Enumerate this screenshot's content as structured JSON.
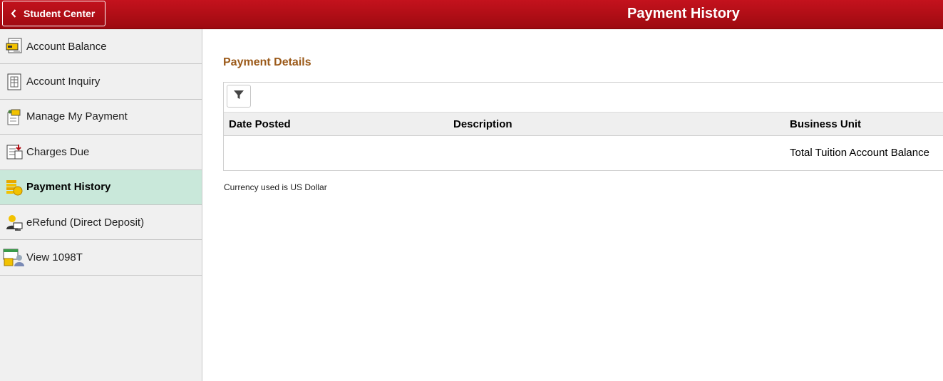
{
  "header": {
    "back_label": "Student Center",
    "title": "Payment History",
    "colors": {
      "bar": "#b30e15",
      "text": "#ffffff"
    }
  },
  "sidebar": {
    "items": [
      {
        "label": "Account Balance",
        "icon": "account-balance-icon"
      },
      {
        "label": "Account Inquiry",
        "icon": "account-inquiry-icon"
      },
      {
        "label": "Manage My Payment",
        "icon": "manage-payment-icon"
      },
      {
        "label": "Charges Due",
        "icon": "charges-due-icon"
      },
      {
        "label": "Payment History",
        "icon": "payment-history-icon",
        "active": true
      },
      {
        "label": "eRefund (Direct Deposit)",
        "icon": "erefund-icon"
      },
      {
        "label": "View 1098T",
        "icon": "view-1098t-icon"
      }
    ],
    "active_color": "#c9e8da"
  },
  "main": {
    "section_title": "Payment Details",
    "table": {
      "columns": [
        "Date Posted",
        "Description",
        "Business Unit"
      ],
      "rows": [
        {
          "date_posted": "",
          "description": "",
          "business_unit": "Total Tuition Account Balance"
        }
      ]
    },
    "currency_note": "Currency used is US Dollar"
  }
}
